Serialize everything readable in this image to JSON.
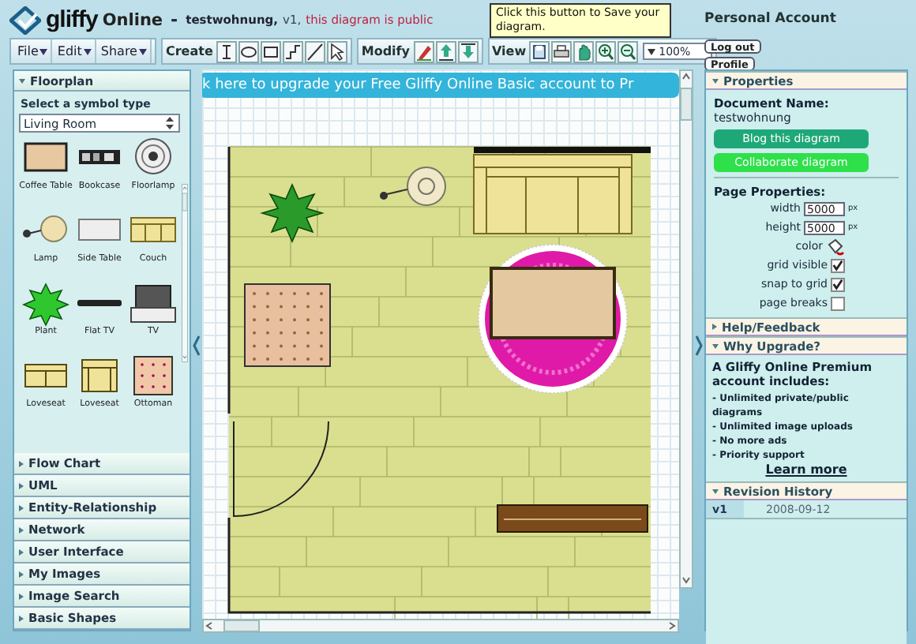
{
  "header": {
    "logo": "gliffy",
    "product": "Online",
    "separator": "-",
    "document": "testwohnung,",
    "version": "v1,",
    "visibility": "this diagram is public",
    "account": "Personal Account",
    "links": [
      "Log out",
      "Profile"
    ]
  },
  "tooltip": "Click this button to Save your diagram.",
  "menus": [
    "File",
    "Edit",
    "Share"
  ],
  "toolbar": {
    "create_label": "Create",
    "modify_label": "Modify",
    "view_label": "View",
    "zoom": "100%"
  },
  "left_panel": {
    "title": "Floorplan",
    "expanded": true,
    "prompt": "Select a symbol type",
    "symbol_type": "Living Room",
    "symbols": [
      {
        "label": "Coffee Table",
        "kind": "coffee-table"
      },
      {
        "label": "Bookcase",
        "kind": "bookcase"
      },
      {
        "label": "Floorlamp",
        "kind": "floorlamp"
      },
      {
        "label": "Lamp",
        "kind": "lamp"
      },
      {
        "label": "Side Table",
        "kind": "side-table"
      },
      {
        "label": "Couch",
        "kind": "couch"
      },
      {
        "label": "Plant",
        "kind": "plant"
      },
      {
        "label": "Flat TV",
        "kind": "flat-tv"
      },
      {
        "label": "TV",
        "kind": "tv"
      },
      {
        "label": "Loveseat",
        "kind": "loveseat"
      },
      {
        "label": "Loveseat",
        "kind": "armchair"
      },
      {
        "label": "Ottoman",
        "kind": "ottoman"
      }
    ],
    "sections": [
      {
        "title": "Flow Chart",
        "expanded": false
      },
      {
        "title": "UML",
        "expanded": false
      },
      {
        "title": "Entity-Relationship",
        "expanded": false
      },
      {
        "title": "Network",
        "expanded": false
      },
      {
        "title": "User Interface",
        "expanded": false
      },
      {
        "title": "My Images",
        "expanded": false
      },
      {
        "title": "Image Search",
        "expanded": false
      },
      {
        "title": "Basic Shapes",
        "expanded": false
      }
    ]
  },
  "canvas": {
    "banner": "k here to upgrade your Free Gliffy Online Basic account to Pr"
  },
  "properties": {
    "title": "Properties",
    "expanded": true,
    "doc_label": "Document Name:",
    "doc_name": "testwohnung",
    "buttons": [
      {
        "label": "Blog this diagram",
        "kind": "blog"
      },
      {
        "label": "Collaborate diagram",
        "kind": "collaborate"
      }
    ],
    "page_label": "Page Properties:",
    "fields": [
      {
        "label": "width",
        "value": "5000",
        "unit": "px"
      },
      {
        "label": "height",
        "value": "5000",
        "unit": "px"
      }
    ],
    "color_label": "color",
    "options": [
      {
        "label": "grid visible",
        "checked": true
      },
      {
        "label": "snap to grid",
        "checked": true
      },
      {
        "label": "page breaks",
        "checked": false
      }
    ]
  },
  "help": {
    "title": "Help/Feedback",
    "expanded": false
  },
  "upgrade": {
    "title": "Why Upgrade?",
    "expanded": true,
    "heading": "A Gliffy Online Premium account includes:",
    "items": [
      "- Unlimited private/public diagrams",
      "- Unlimited image uploads",
      "- No more ads",
      "- Priority support"
    ],
    "link": "Learn more"
  },
  "revisions": {
    "title": "Revision History",
    "expanded": true,
    "rows": [
      {
        "version": "v1",
        "date": "2008-09-12"
      }
    ]
  }
}
